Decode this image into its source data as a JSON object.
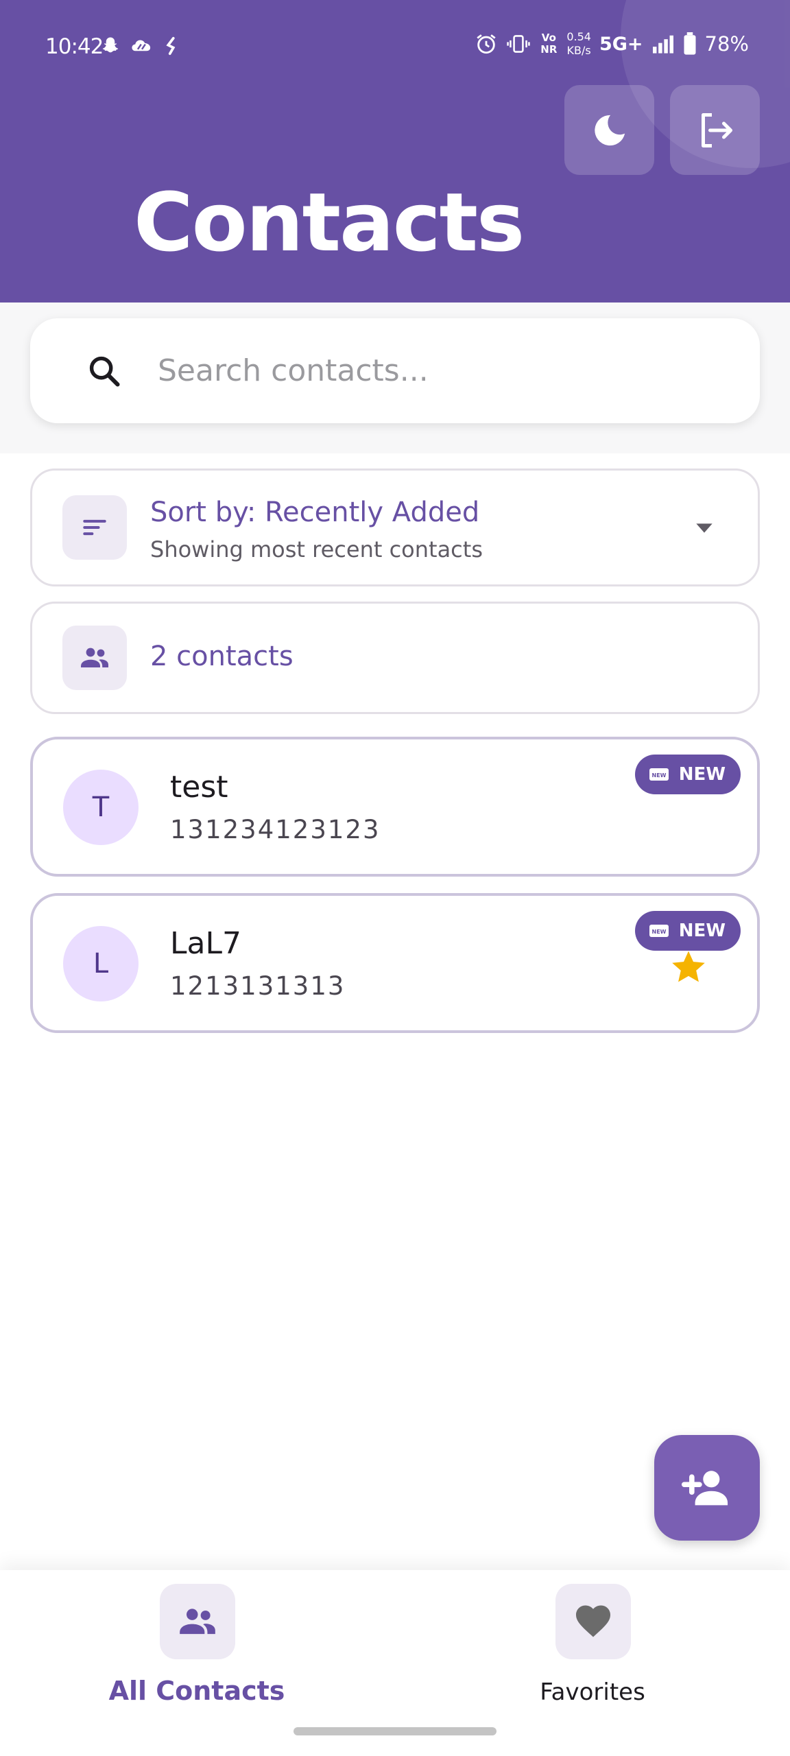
{
  "status_bar": {
    "time": "10:42",
    "net_speed_value": "0.54",
    "net_speed_unit": "KB/s",
    "network_type": "5G+",
    "volte_label": "Vo NR",
    "battery": "78%",
    "left_icons": [
      "snapchat-icon",
      "cloud-icon",
      "app-icon"
    ],
    "right_icons": [
      "alarm-icon",
      "vibrate-icon",
      "signal-icon",
      "battery-icon"
    ]
  },
  "header": {
    "title": "Contacts",
    "theme_button": "moon-icon",
    "logout_button": "logout-icon",
    "background_color": "#6750a4"
  },
  "search": {
    "placeholder": "Search contacts..."
  },
  "sort": {
    "label": "Sort by: Recently Added",
    "subtitle": "Showing most recent contacts"
  },
  "summary": {
    "count_label": "2 contacts"
  },
  "contacts": [
    {
      "initial": "T",
      "name": "test",
      "phone": "131234123123",
      "badge": "NEW",
      "favorite": false
    },
    {
      "initial": "L",
      "name": "LaL7",
      "phone": "1213131313",
      "badge": "NEW",
      "favorite": true
    }
  ],
  "fab": {
    "icon": "add-person-icon"
  },
  "bottom_nav": {
    "items": [
      {
        "label": "All Contacts",
        "icon": "people-icon",
        "active": true
      },
      {
        "label": "Favorites",
        "icon": "heart-icon",
        "active": false
      }
    ]
  },
  "colors": {
    "accent": "#6750a4",
    "avatar_bg": "#eaddff",
    "star": "#f5b301"
  }
}
